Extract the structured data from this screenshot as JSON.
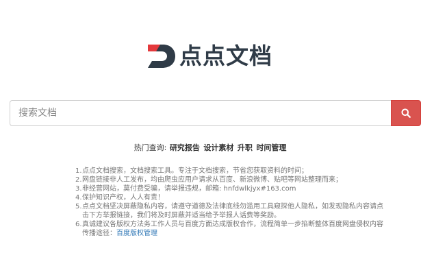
{
  "logo": {
    "text": "点点文档"
  },
  "search": {
    "placeholder": "搜索文档",
    "button_icon": "search-icon"
  },
  "hot": {
    "label": "热门查询:",
    "links": [
      "研究报告",
      "设计素材",
      "升职",
      "时间管理"
    ]
  },
  "notice": {
    "items": [
      {
        "num": "1.",
        "text": "点点文档搜索，文档搜索工具。专注于文档搜索，节省您获取资料的时间；"
      },
      {
        "num": "2.",
        "text": "网盘链接非人工发布，均由爬虫应用户请求从百度、新浪微博、贴吧等网站整理而来；"
      },
      {
        "num": "3.",
        "text": "非经营网站，莫付费受骗，请举报违规，邮箱: hnfdwlkjyx#163.com"
      },
      {
        "num": "4.",
        "text": "保护知识产权，人人有责！"
      },
      {
        "num": "5.",
        "text": "点点文档坚决屏蔽隐私内容，请遵守道德及法律底线勿滥用工具窥探他人隐私，如发现隐私内容请点击下方举报链接，我们将及时屏蔽并适当给予举报人话费等奖励。"
      },
      {
        "num": "6.",
        "text": "真诚建议各版权方法务工作人员与百度方面达成版权合作，流程简单一步掐断整体百度网盘侵权内容传播途径：",
        "link": "百度版权管理"
      }
    ]
  },
  "colors": {
    "accent": "#d9534f",
    "brand_red": "#e4393c",
    "brand_dark": "#2f3b47",
    "link": "#337ab7"
  }
}
